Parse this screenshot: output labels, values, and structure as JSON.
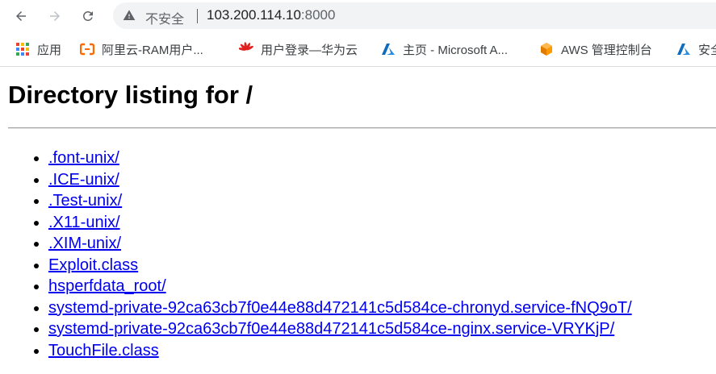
{
  "browser": {
    "nav": [
      "back-icon",
      "forward-icon",
      "reload-icon"
    ],
    "address_bar": {
      "security_icon": "warning-triangle-icon",
      "security_label": "不安全",
      "host": "103.200.114.10",
      "port": ":8000"
    },
    "bookmarks": [
      {
        "label": "应用",
        "icon": "apps-grid-icon"
      },
      {
        "label": "阿里云-RAM用户...",
        "icon": "aliyun-icon"
      },
      {
        "label": "用户登录—华为云",
        "icon": "huawei-icon"
      },
      {
        "label": "主页 - Microsoft A...",
        "icon": "azure-icon"
      },
      {
        "label": "AWS 管理控制台",
        "icon": "aws-icon"
      },
      {
        "label": "安全",
        "icon": "azure-icon"
      }
    ]
  },
  "page": {
    "title": "Directory listing for /",
    "entries": [
      ".font-unix/",
      ".ICE-unix/",
      ".Test-unix/",
      ".X11-unix/",
      ".XIM-unix/",
      "Exploit.class",
      "hsperfdata_root/",
      "systemd-private-92ca63cb7f0e44e88d472141c5d584ce-chronyd.service-fNQ9oT/",
      "systemd-private-92ca63cb7f0e44e88d472141c5d584ce-nginx.service-VRYKjP/",
      "TouchFile.class"
    ]
  },
  "colors": {
    "link": "#0000ee",
    "omnibox_bg": "#f1f3f4",
    "aliyun": "#ff6a00",
    "huawei": "#e0211f",
    "azure": "#0f6cbd",
    "aws": "#ff9900"
  }
}
